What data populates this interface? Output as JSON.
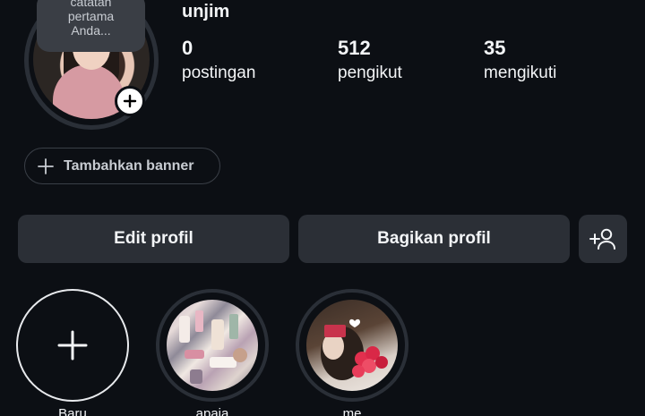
{
  "profile": {
    "username": "unjim",
    "note": [
      "catatan",
      "pertama",
      "Anda..."
    ]
  },
  "stats": [
    {
      "value": "0",
      "label": "postingan"
    },
    {
      "value": "512",
      "label": "pengikut"
    },
    {
      "value": "35",
      "label": "mengikuti"
    }
  ],
  "banner": {
    "label": "Tambahkan banner"
  },
  "actions": {
    "edit_label": "Edit profil",
    "share_label": "Bagikan profil"
  },
  "highlights": [
    {
      "label": "Baru"
    },
    {
      "label": "apaja"
    },
    {
      "label": "me"
    }
  ],
  "icons": {
    "add_story": "plus-icon",
    "banner": "plus-icon",
    "discover": "add-person-icon",
    "new_highlight": "plus-icon"
  },
  "colors": {
    "background": "#0c0f14",
    "button": "#2b2f36",
    "text": "#f3f5f7"
  }
}
